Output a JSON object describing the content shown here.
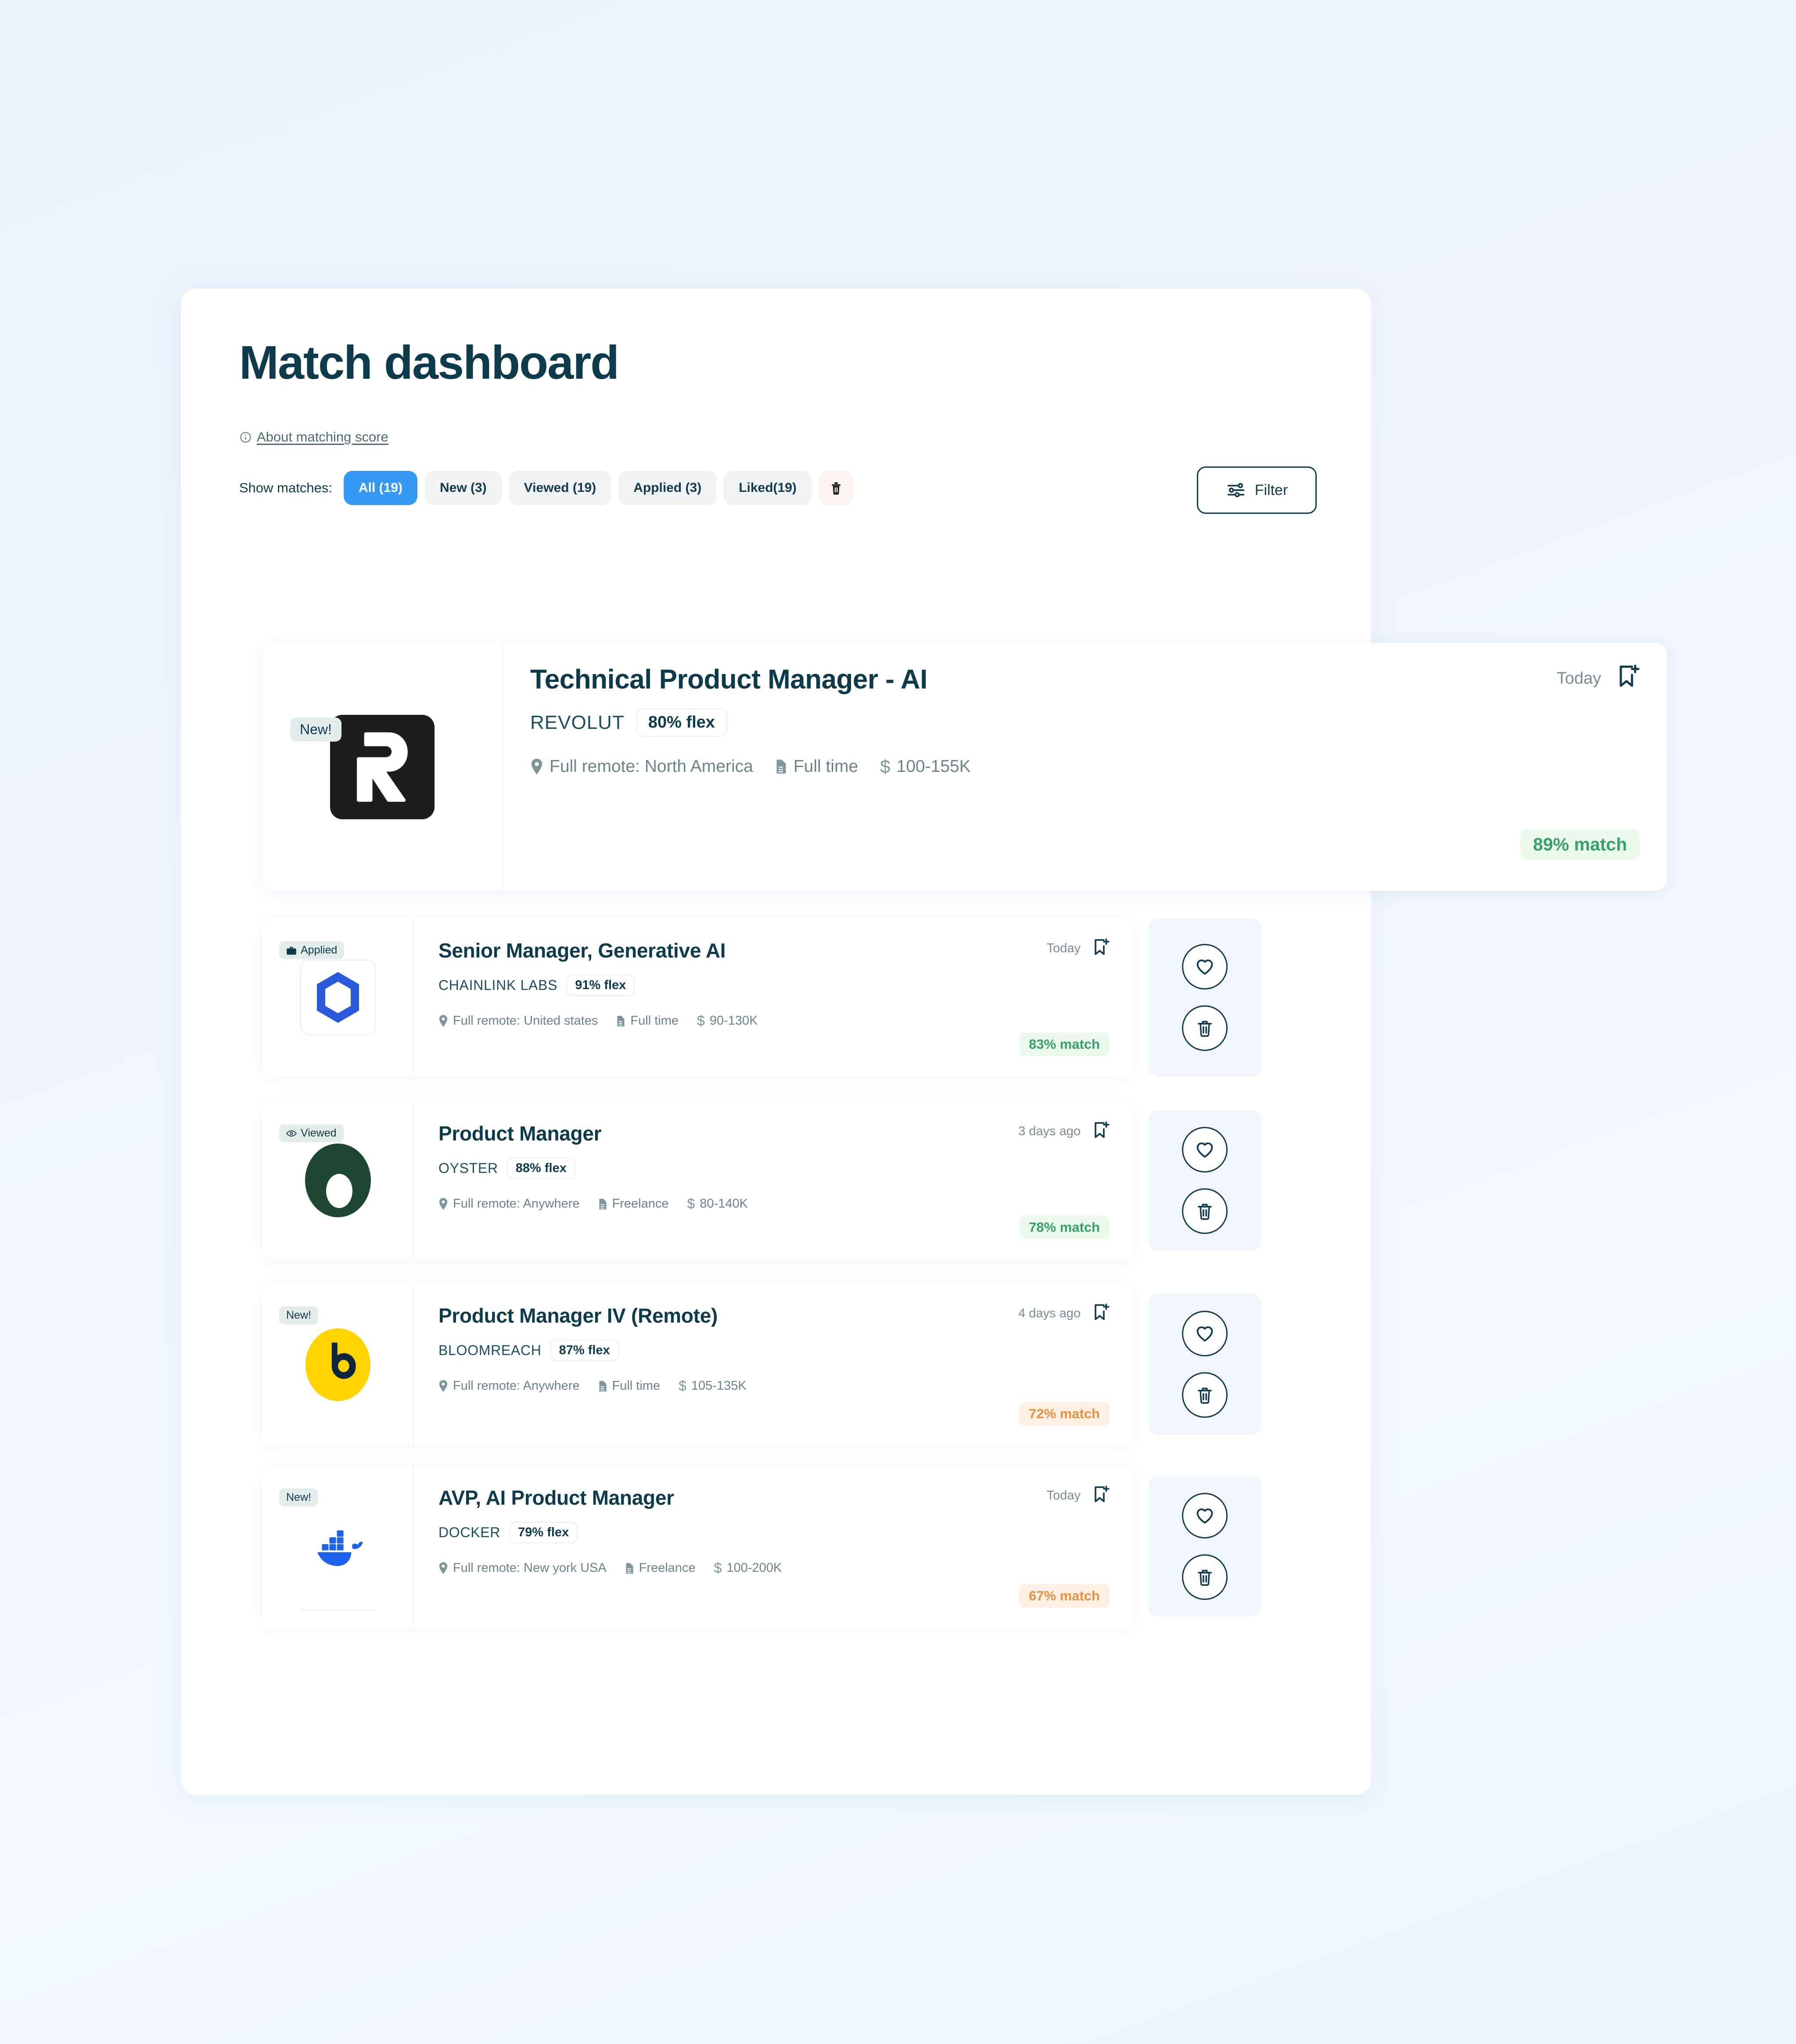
{
  "header": {
    "title": "Match dashboard",
    "about_link": "About matching score",
    "info_icon": "info-circle-icon"
  },
  "filters": {
    "label": "Show matches:",
    "chips": [
      {
        "label": "All (19)",
        "active": true
      },
      {
        "label": "New (3)",
        "active": false
      },
      {
        "label": "Viewed (19)",
        "active": false
      },
      {
        "label": "Applied (3)",
        "active": false
      },
      {
        "label": "Liked(19)",
        "active": false
      }
    ],
    "clear_icon": "trash-icon",
    "filter_button": {
      "label": "Filter",
      "icon": "sliders-icon"
    }
  },
  "featured": {
    "badge": "New!",
    "logo": "revolut-logo",
    "title": "Technical Product Manager - AI",
    "company": "REVOLUT",
    "flex": "80% flex",
    "location": "Full remote: North America",
    "employment": "Full time",
    "salary": "100-155K",
    "date": "Today",
    "bookmark_icon": "bookmark-add-icon",
    "match": "89% match",
    "match_tone": "green"
  },
  "jobs": [
    {
      "badge": "Applied",
      "badge_icon": "briefcase-icon",
      "logo": "chainlink-logo",
      "logo_framed": true,
      "title": "Senior Manager, Generative AI",
      "company": "CHAINLINK LABS",
      "flex": "91% flex",
      "location": "Full remote: United states",
      "employment": "Full time",
      "salary": "90-130K",
      "date": "Today",
      "match": "83% match",
      "match_tone": "green"
    },
    {
      "badge": "Viewed",
      "badge_icon": "eye-icon",
      "logo": "oyster-logo",
      "logo_framed": false,
      "title": "Product Manager",
      "company": "OYSTER",
      "flex": "88% flex",
      "location": "Full remote: Anywhere",
      "employment": "Freelance",
      "salary": "80-140K",
      "date": "3 days ago",
      "match": "78% match",
      "match_tone": "green"
    },
    {
      "badge": "New!",
      "badge_icon": "",
      "logo": "bloomreach-logo",
      "logo_framed": false,
      "title": "Product Manager IV (Remote)",
      "company": "BLOOMREACH",
      "flex": "87% flex",
      "location": "Full remote: Anywhere",
      "employment": "Full time",
      "salary": "105-135K",
      "date": "4 days ago",
      "match": "72% match",
      "match_tone": "orange"
    },
    {
      "badge": "New!",
      "badge_icon": "",
      "logo": "docker-logo",
      "logo_framed": false,
      "title": "AVP, AI Product Manager",
      "company": "DOCKER",
      "flex": "79% flex",
      "location": "Full remote: New york USA",
      "employment": "Freelance",
      "salary": "100-200K",
      "date": "Today",
      "match": "67% match",
      "match_tone": "orange"
    }
  ],
  "row_actions": {
    "like_icon": "heart-icon",
    "delete_icon": "trash-icon"
  },
  "icons": {
    "location": "map-pin-icon",
    "employment": "document-icon",
    "salary": "dollar-icon"
  },
  "colors": {
    "brand_dark": "#0d3b4c",
    "accent_blue": "#3699f3",
    "match_green": "#38a169",
    "match_orange": "#e39343",
    "page_bg": "#eef4fd"
  }
}
